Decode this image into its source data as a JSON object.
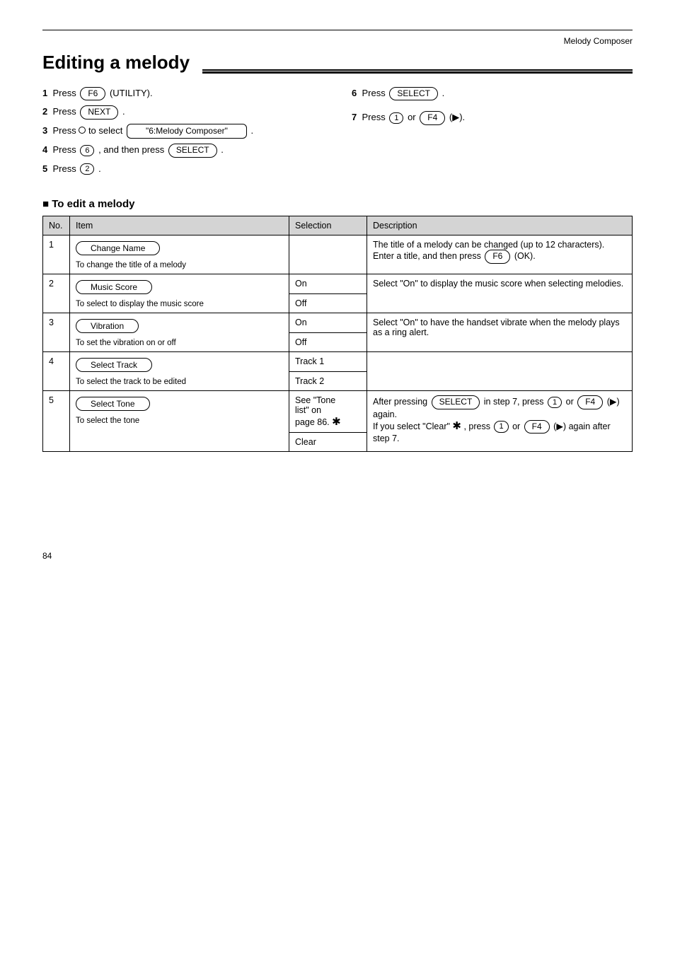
{
  "header": {
    "right_label": "Melody Composer",
    "page_num": "84"
  },
  "title": "Editing a melody",
  "preamble": {
    "left": {
      "i1_pre": "Press ",
      "i1_btn": "F6",
      "i1_post": " (UTILITY).",
      "i2_pre": "Press ",
      "i2_btn": "NEXT",
      "i2_post": ".",
      "i3_pre_a": "Press ",
      "i3_pre_b": " to select ",
      "i3_num": "6",
      "i3_item": "\"6:Melody Composer\"",
      "i3_post": ".",
      "i4_pre": "Press ",
      "i4_btn1": "6",
      "i4_mid": ", and then press ",
      "i4_btn2": "SELECT",
      "i4_post": ".",
      "i5_pre": "Press ",
      "i5_btn": "2",
      "i5_post": "."
    },
    "right": {
      "r1_pre": "Press ",
      "r1_btn": "SELECT",
      "r1_post": ".",
      "r2_pre": "Press ",
      "r2_btn_a": "1",
      "r2_btn_b": "F4",
      "r2_mid": " or ",
      "r2_post": " (▶)."
    }
  },
  "subheading": "■ To edit a melody",
  "table": {
    "headers": [
      "No.",
      "Item",
      "Selection",
      "Description"
    ],
    "rows": [
      {
        "no": "1",
        "item_oval": "Change Name",
        "item_desc": "To change the title of a melody",
        "sel": "",
        "desc": "The title of a melody can be changed (up to 12 characters). Enter a title, and then press  F6  (OK)."
      },
      {
        "no": "2",
        "item_oval": "Music Score",
        "item_desc": "To select to display the music score",
        "sel_a": "On",
        "sel_b": "Off",
        "desc": "Select \"On\" to display the music score when selecting melodies."
      },
      {
        "no": "3",
        "item_oval": "Vibration",
        "item_desc": "To set the vibration on or off",
        "sel_a": "On",
        "sel_b": "Off",
        "desc": "Select \"On\" to have the handset vibrate when the melody plays as a ring alert."
      },
      {
        "no": "4",
        "item_oval": "Select Track",
        "item_desc": "To select the track to be edited",
        "sel_a": "Track 1",
        "sel_b": "Track 2",
        "desc": ""
      },
      {
        "no": "5",
        "item_oval": "Select Tone",
        "item_desc": "To select the tone",
        "sel_a_lines": [
          "See \"Tone",
          "list\" on",
          "page 86."
        ],
        "sel_b": "Clear",
        "desc_pre": "After pressing ",
        "desc_btn1": "SELECT",
        "desc_mid1": " in step 7, press ",
        "desc_btn2a": "1",
        "desc_mid2": " or ",
        "desc_btn2b": "F4",
        "desc_post1": " (▶) again.",
        "desc_line2_pre": "If you select \"Clear\" ",
        "desc_line2_post": ", press ",
        "desc_btn3a": "1",
        "desc_btn3b": "F4",
        "desc_line2_or": " or ",
        "desc_line2_end": " (▶) again after step 7."
      }
    ]
  },
  "btns": {
    "f6": "F6",
    "next": "NEXT",
    "select": "SELECT",
    "f4": "F4",
    "num1": "1",
    "num2": "2",
    "num6": "6"
  }
}
